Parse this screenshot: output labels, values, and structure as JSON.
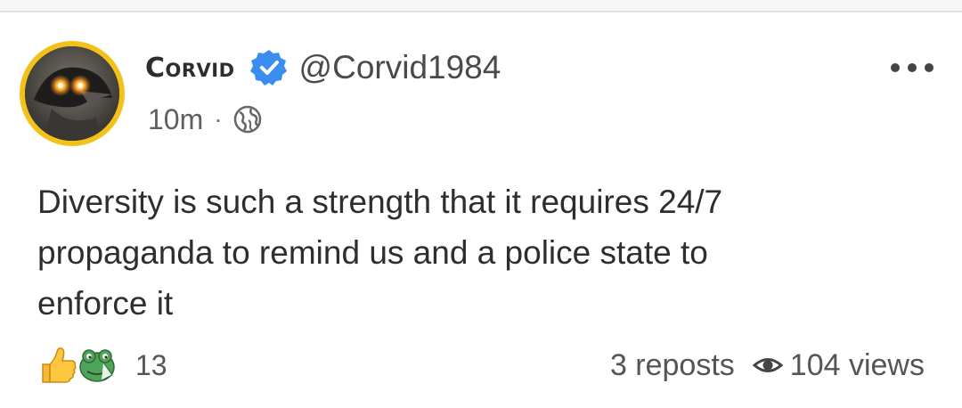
{
  "post": {
    "author": {
      "display_name": "Corvid",
      "handle": "@Corvid1984",
      "verified": true,
      "avatar_icon": "crow-avatar",
      "avatar_ring_color": "#f2c21b",
      "verified_color": "#3b8ef0"
    },
    "meta": {
      "time": "10m",
      "separator": "·",
      "visibility_icon": "globe-icon"
    },
    "menu_icon": "more-horizontal-icon",
    "text": "Diversity is such a strength that it requires 24/7\npropaganda to remind us and a police state to\nenforce it",
    "reactions": {
      "icons": [
        "thumbs-up-icon",
        "frog-emoji-icon"
      ],
      "count": "13"
    },
    "stats": {
      "reposts": "3 reposts",
      "views_icon": "eye-icon",
      "views": "104 views"
    }
  }
}
